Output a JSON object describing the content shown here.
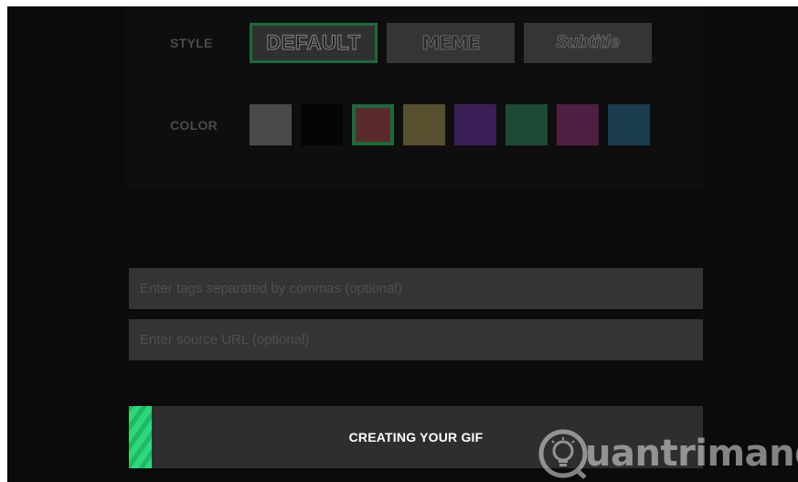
{
  "style_section": {
    "label": "STYLE",
    "options": [
      {
        "label": "DEFAULT",
        "selected": true
      },
      {
        "label": "MEME",
        "selected": false
      },
      {
        "label": "Subtitle",
        "selected": false
      }
    ]
  },
  "color_section": {
    "label": "COLOR",
    "swatches": [
      {
        "name": "white",
        "color": "#4a4a4a",
        "selected": false
      },
      {
        "name": "black",
        "color": "#050505",
        "selected": false
      },
      {
        "name": "red",
        "color": "#5a2a2c",
        "selected": true
      },
      {
        "name": "yellow",
        "color": "#57502f",
        "selected": false
      },
      {
        "name": "purple",
        "color": "#3a1f57",
        "selected": false
      },
      {
        "name": "green",
        "color": "#1d4a35",
        "selected": false
      },
      {
        "name": "magenta",
        "color": "#4f1f42",
        "selected": false
      },
      {
        "name": "blue",
        "color": "#1b3c4f",
        "selected": false
      }
    ],
    "selected_border": "#1d6a3b"
  },
  "tags_input": {
    "placeholder": "Enter tags separated by commas (optional)",
    "value": ""
  },
  "source_input": {
    "placeholder": "Enter source URL (optional)",
    "value": ""
  },
  "progress": {
    "label": "CREATING YOUR GIF",
    "fraction": 0.04,
    "color": "#2bd97c"
  },
  "watermark": {
    "text": "uantrimang"
  }
}
